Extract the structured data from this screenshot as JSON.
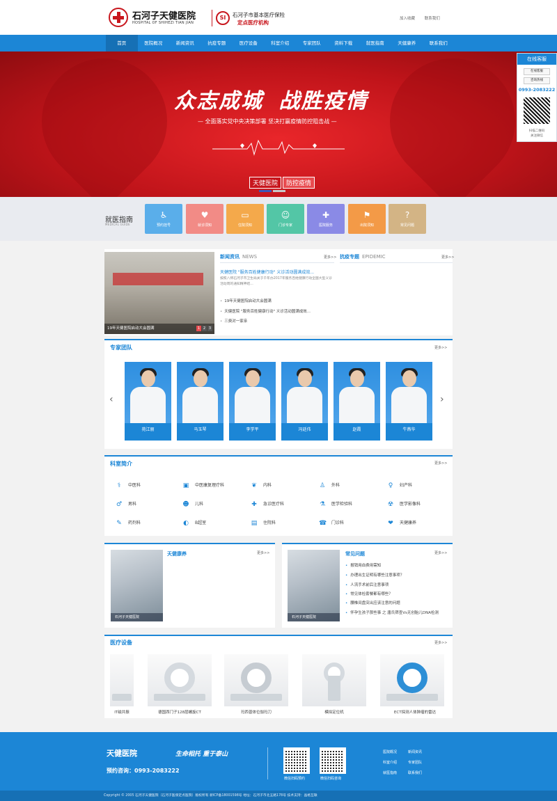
{
  "header": {
    "hospital_name_cn": "石河子天健医院",
    "hospital_name_en": "HOSPITAL OF SHIHEZI TIAN JIAN",
    "insurance_logo": "SI",
    "insurance_line1": "石河子市基本医疗保险",
    "insurance_line2": "定点医疗机构",
    "top_links": [
      "加入收藏",
      "联系我们"
    ]
  },
  "nav": [
    "首页",
    "医院概况",
    "新闻资讯",
    "抗疫专题",
    "医疗设备",
    "科室介绍",
    "专家团队",
    "资料下载",
    "就医指南",
    "天健康养",
    "联系我们"
  ],
  "banner": {
    "title_a": "众志成城",
    "title_b": "战胜疫情",
    "subtitle": "— 全面落实党中央决策部署  坚决打赢疫情防控阻击战 —",
    "tag_a": "天健医院",
    "tag_b": "防控疫情"
  },
  "guide": {
    "title": "就医指南",
    "title_en": "MEDICAL GUIDE",
    "tiles": [
      {
        "label": "预约挂号",
        "icon": "doctor-desk-icon",
        "color": "#5aaeea"
      },
      {
        "label": "就诊须知",
        "icon": "heart-hand-icon",
        "color": "#f28b86"
      },
      {
        "label": "住院须知",
        "icon": "bed-icon",
        "color": "#f4a94b"
      },
      {
        "label": "门诊专家",
        "icon": "doctors-icon",
        "color": "#53c6a6"
      },
      {
        "label": "医院服务",
        "icon": "service-icon",
        "color": "#8a8ae6"
      },
      {
        "label": "出院须知",
        "icon": "discharge-icon",
        "color": "#f39a47"
      },
      {
        "label": "常见问题",
        "icon": "question-icon",
        "color": "#d3b485"
      }
    ]
  },
  "news": {
    "tab_news": "新闻资讯",
    "tab_news_en": "NEWS",
    "tab_epidemic": "抗疫专题",
    "tab_epidemic_en": "EPIDEMIC",
    "more": "更多>>",
    "slide_caption": "19年天健医院启动大会圆满",
    "pages": [
      "1",
      "2",
      "3"
    ],
    "headline": "天健医院 \"服务百姓健康行动\" 义诊活动圆满成效...",
    "desc": "按照八师石河子市卫生局关于千年办2017年服务百姓健康行动全国大型义诊活动周的通知精神结...",
    "items": [
      "19年天健医院启动大会圆满",
      "天健医院 \"服务百姓健康行动\" 义诊活动圆满成效...",
      "三费对一家亲"
    ]
  },
  "experts": {
    "title": "专家团队",
    "more": "更多>>",
    "doctors": [
      "苑江丽",
      "马玉琴",
      "李学平",
      "冯廷伟",
      "赵霞",
      "牛燕华"
    ]
  },
  "departments": {
    "title": "科室简介",
    "more": "更多>>",
    "items": [
      {
        "name": "中医科",
        "icon": "herbal-icon"
      },
      {
        "name": "中医康复理疗科",
        "icon": "monitor-heart-icon"
      },
      {
        "name": "内科",
        "icon": "lungs-icon"
      },
      {
        "name": "外科",
        "icon": "surgeon-icon"
      },
      {
        "name": "妇产科",
        "icon": "pregnant-icon"
      },
      {
        "name": "男科",
        "icon": "male-icon"
      },
      {
        "name": "儿科",
        "icon": "child-icon"
      },
      {
        "name": "急诊医疗科",
        "icon": "ambulance-icon"
      },
      {
        "name": "医学检验科",
        "icon": "microscope-icon"
      },
      {
        "name": "医学影像科",
        "icon": "xray-icon"
      },
      {
        "name": "药剂科",
        "icon": "syringe-icon"
      },
      {
        "name": "B超室",
        "icon": "ultrasound-icon"
      },
      {
        "name": "住院科",
        "icon": "ward-icon"
      },
      {
        "name": "门诊科",
        "icon": "outpatient-icon"
      },
      {
        "name": "天健康养",
        "icon": "care-icon"
      }
    ]
  },
  "health": {
    "title": "天健康养",
    "more": "更多>>",
    "photo_band": "石河子天健医院"
  },
  "faq": {
    "title": "常见问题",
    "more": "更多>>",
    "photo_band": "石河子天健医院",
    "items": [
      "报销用血费用需知",
      "办理出生证明有哪些注意事项？",
      "人流手术前后注意事项",
      "常见体检套餐都有哪些？",
      "腰椎间盘突出应该注意的问题",
      "怀孕生孩子那些事 之 唐氏筛查Vs无创胎儿DNA检测"
    ]
  },
  "equipment": {
    "title": "医疗设备",
    "more": "更多>>",
    "items": [
      "IT磁共振",
      "德国西门子128层螺旋CT",
      "玛西普体位伽玛刀",
      "模拟定位机",
      "ECT探测人体肿瘤的雷达"
    ]
  },
  "footer": {
    "logo": "天健医院",
    "slogan": "生命相托 重于泰山",
    "tel": "预约咨询：0993-2083222",
    "qr_captions": [
      "微信扫码预约",
      "微信扫码咨询"
    ],
    "links": [
      "医院概况",
      "新闻资讯",
      "科室介绍",
      "专家团队",
      "就医指南",
      "联系我们"
    ],
    "copyright": "Copyright © 2005 石河子天健医院（石河子医保定点医院）版权所有 新ICP备18001598号 地址：石河子市北五路178号 技术支持：晶格互联"
  },
  "service": {
    "title": "在线客服",
    "btn_online": "在线客服",
    "btn_hotline": "咨询热线",
    "tel": "0993-2083222",
    "qr_caption_1": "扫描二维码",
    "qr_caption_2": "关注微信"
  }
}
